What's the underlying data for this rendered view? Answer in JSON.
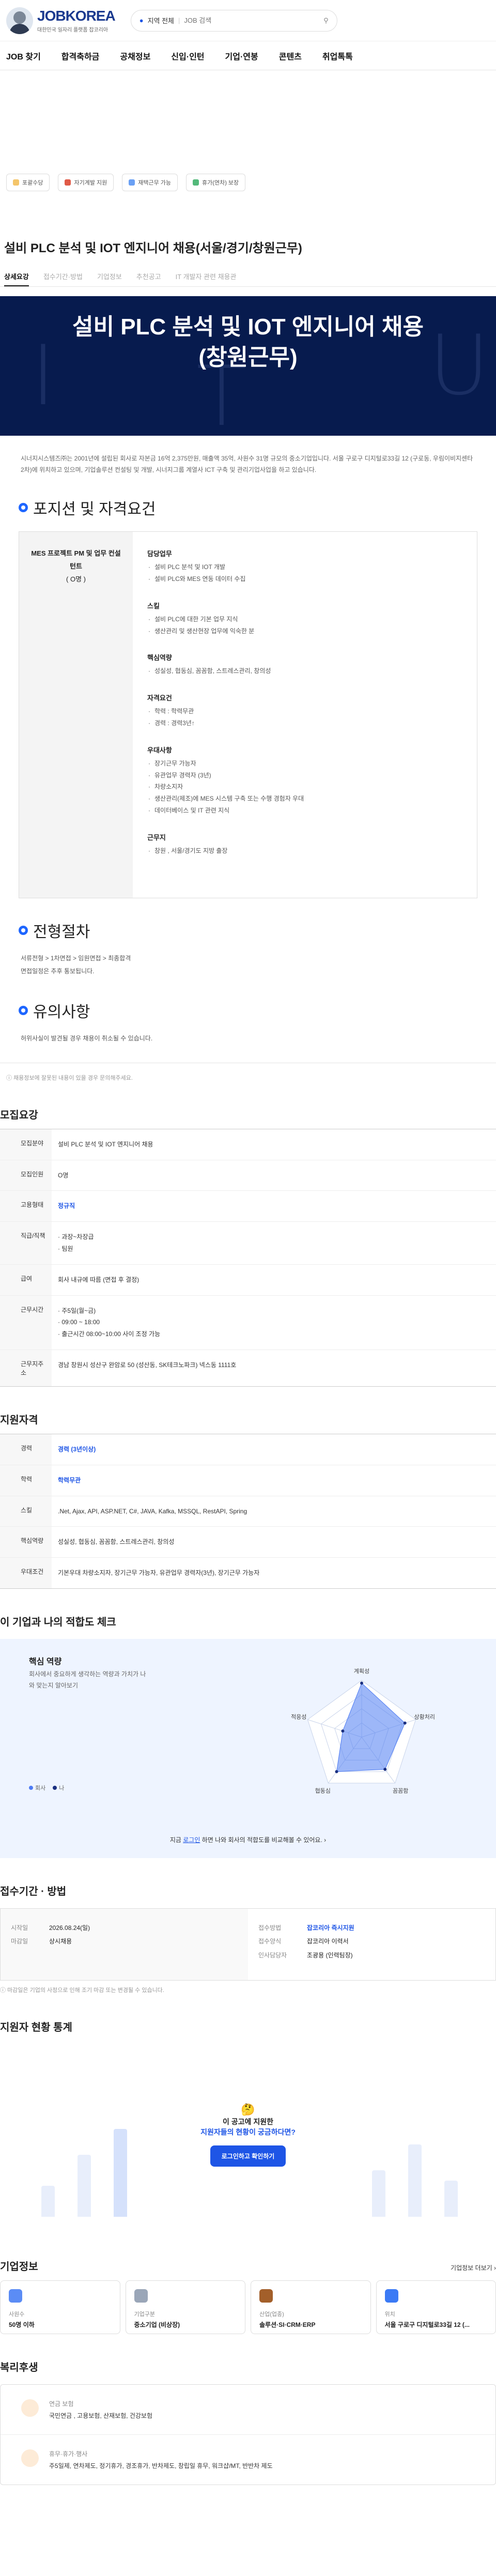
{
  "header": {
    "logo_text": "JOBKOREA",
    "logo_sub": "대한민국 일자리 플랫폼 잡코리아",
    "location": "지역 전체",
    "search_placeholder": "JOB 검색"
  },
  "nav": [
    "JOB 찾기",
    "합격축하금",
    "공채정보",
    "신입·인턴",
    "기업·연봉",
    "콘텐츠",
    "취업톡톡"
  ],
  "chips": [
    {
      "label": "포괄수당",
      "color": "#f4c56a"
    },
    {
      "label": "자기계발 지원",
      "color": "#e05a47"
    },
    {
      "label": "재택근무 가능",
      "color": "#6aa0f4"
    },
    {
      "label": "휴가(연차) 보장",
      "color": "#53b97a"
    }
  ],
  "job": {
    "title": "설비 PLC 분석 및 IOT 엔지니어 채용(서울/경기/창원근무)",
    "tabs": [
      "상세요강",
      "접수기간·방법",
      "기업정보",
      "추천공고",
      "IT 개발자 관련 채용관"
    ],
    "hero_line1": "설비 PLC 분석 및 IOT 엔지니어 채용",
    "hero_line2": "(창원근무)",
    "intro": "시너지시스템즈㈜는 2001년에 설립된 회사로 자본금 16억 2,375만원, 매출액 35억, 사원수 31명 규모의 중소기업입니다. 서울 구로구 디지털로33길 12 (구로동, 우림이비지센타2차)에 위치하고 있으며, 기업솔루션 컨설팅 및 개발, 시너지그룹 계열사 ICT 구축 및 관리기업사업을 하고 있습니다."
  },
  "qualifications": {
    "section_title": "포지션 및 자격요건",
    "position": "MES 프로젝트 PM 및 업무 컨설턴트",
    "headcount": "( O명 )",
    "groups": [
      {
        "title": "담당업무",
        "items": [
          "설비 PLC 분석 및 IOT 개발",
          "설비 PLC와 MES 연동 데이터 수집"
        ]
      },
      {
        "title": "스킬",
        "items": [
          "설비 PLC에 대한 기본 업무 지식",
          "생산관리 및 생산현장 업무에 익숙한 분"
        ]
      },
      {
        "title": "핵심역량",
        "items": [
          "성실성, 협동심, 꼼꼼함, 스트레스관리, 창의성"
        ]
      },
      {
        "title": "자격요건",
        "items": [
          "학력 : 학력무관",
          "경력 : 경력3년↑"
        ]
      },
      {
        "title": "우대사항",
        "items": [
          "장기근무 가능자",
          "유관업무 경력자 (3년)",
          "차량소지자",
          "생산관리(제조)에 MES 시스템 구축 또는 수행 경험자 우대",
          "데이터베이스 및 IT 관련 지식"
        ]
      },
      {
        "title": "근무지",
        "items": [
          "창원 , 서울/경기도 지방 출장"
        ]
      }
    ]
  },
  "process": {
    "section_title": "전형절차",
    "steps": [
      "서류전형 > 1차면접 > 임원면접 > 최종합격",
      "면접일정은 추후 통보됩니다."
    ]
  },
  "notice": {
    "section_title": "유의사항",
    "items": [
      "허위사실이 발견될 경우 채용이 취소될 수 있습니다."
    ]
  },
  "disclaimer": "채용정보에 잘못된 내용이 있을 경우 문의해주세요.",
  "summary": {
    "title": "모집요강",
    "rows": [
      {
        "k": "모집분야",
        "v": [
          "설비 PLC 분석 및 IOT 엔지니어 채용"
        ]
      },
      {
        "k": "모집인원",
        "v": [
          "O명"
        ]
      },
      {
        "k": "고용형태",
        "v": [
          "정규직"
        ],
        "blue": true
      },
      {
        "k": "직급/직책",
        "v": [
          "· 과장~차장급",
          "· 팀원"
        ]
      },
      {
        "k": "급여",
        "v": [
          "회사 내규에 따름 (면접 후 결정)"
        ]
      },
      {
        "k": "근무시간",
        "v": [
          "· 주5일(월~금)",
          "· 09:00 ~ 18:00",
          "· 출근시간 08:00~10:00 사이 조정 가능"
        ]
      },
      {
        "k": "근무지주소",
        "v": [
          "경남 창원시 성산구 완암로 50 (성산동, SK테크노파크) 넥스동 1111호"
        ]
      }
    ]
  },
  "requirements": {
    "title": "지원자격",
    "rows": [
      {
        "k": "경력",
        "v": "경력 (3년이상)",
        "blue": true
      },
      {
        "k": "학력",
        "v": "학력무관",
        "blue": true
      },
      {
        "k": "스킬",
        "v": ".Net, Ajax, API, ASP.NET, C#, JAVA, Kafka, MSSQL, RestAPI, Spring"
      },
      {
        "k": "핵심역량",
        "v": "성실성, 협동심, 꼼꼼함, 스트레스관리, 창의성"
      },
      {
        "k": "우대조건",
        "v": "기본우대   차량소지자, 장기근무 가능자, 유관업무 경력자(3년), 장기근무 가능자"
      }
    ]
  },
  "fit": {
    "title": "이 기업과 나의 적합도 체크",
    "card_title": "핵심 역량",
    "desc": "회사에서 중요하게 생각하는 역량과 가치가 나와 맞는지 알아보기",
    "legend": [
      "회사",
      "나"
    ],
    "link_prefix": "지금 ",
    "link_text": "로그인",
    "link_suffix": " 하면 나와 회사의 적합도를 비교해볼 수 있어요.",
    "colors": {
      "company": "#4d7bf3",
      "me": "#1a2f80"
    }
  },
  "chart_data": {
    "type": "radar",
    "categories": [
      "계획성",
      "상황처리",
      "꼼꼼함",
      "협동심",
      "적응성"
    ]
  },
  "apply": {
    "title": "접수기간 · 방법",
    "rows_left": [
      {
        "k": "시작일",
        "v": "2026.08.24(일)"
      },
      {
        "k": "마감일",
        "v": "상시채용"
      }
    ],
    "rows_right": [
      {
        "k": "접수방법",
        "v": "잡코리아 즉시지원",
        "blue": true
      },
      {
        "k": "접수양식",
        "v": "잡코리아 이력서"
      },
      {
        "k": "인사담당자",
        "v": "조광용 (인력팀장)"
      }
    ],
    "note": "마감일은 기업의 사정으로 인해 조기 마감 또는 변경될 수 있습니다."
  },
  "stats": {
    "title": "지원자 현황 통계",
    "q1": "이 공고에 지원한",
    "q2": "지원자들의 현황이 궁금하다면?",
    "button": "로그인하고 확인하기"
  },
  "company": {
    "title": "기업정보",
    "more": "기업정보 더보기",
    "cards": [
      {
        "label": "사원수",
        "value": "50명 이하",
        "color": "#5b8cf5"
      },
      {
        "label": "기업구분",
        "value": "중소기업 (비상장)",
        "color": "#9aa6b8"
      },
      {
        "label": "산업(업종)",
        "value": "솔루션·SI·CRM·ERP",
        "color": "#a35f2a"
      },
      {
        "label": "위치",
        "value": "서울 구로구 디지털로33길 12 (...",
        "color": "#3b7af5"
      }
    ]
  },
  "welfare": {
    "title": "복리후생",
    "rows": [
      {
        "t": "연금 보험",
        "v": "국민연금 , 고용보험, 산재보험, 건강보험"
      },
      {
        "t": "휴무·휴가·행사",
        "v": "주5일제, 연차제도, 정기휴가, 경조휴가, 반차제도, 창립일 휴무, 워크샵/MT, 반반차 제도"
      }
    ]
  }
}
